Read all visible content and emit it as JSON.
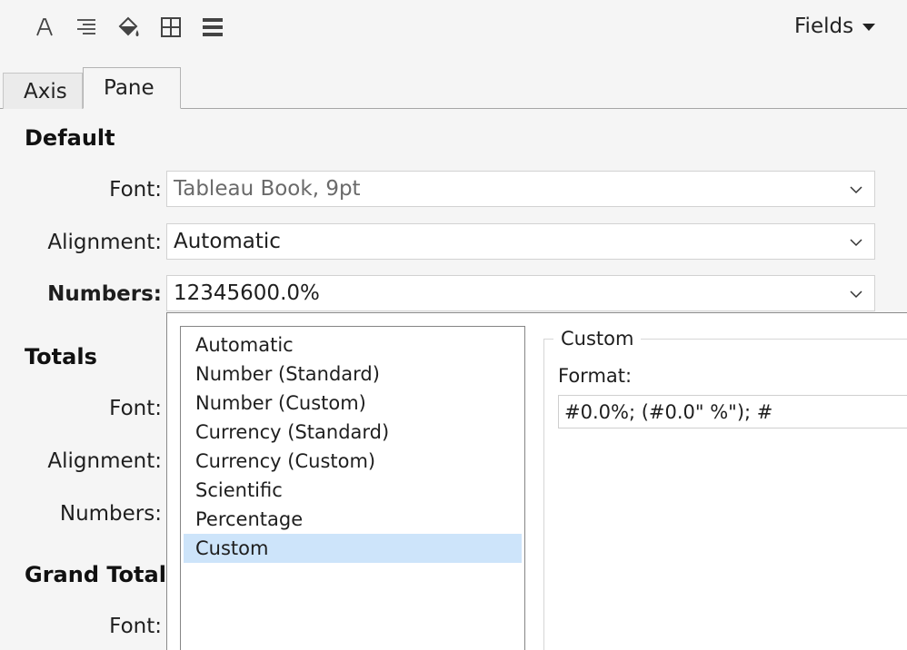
{
  "toolbar": {
    "icons": [
      "font-icon",
      "alignment-icon",
      "shading-icon",
      "borders-icon",
      "lines-icon"
    ],
    "fields_label": "Fields"
  },
  "tabs": [
    {
      "label": "Axis",
      "active": false
    },
    {
      "label": "Pane",
      "active": true
    }
  ],
  "default": {
    "heading": "Default",
    "font_label": "Font:",
    "font_value": "Tableau Book, 9pt",
    "alignment_label": "Alignment:",
    "alignment_value": "Automatic",
    "numbers_label": "Numbers:",
    "numbers_value": "12345600.0%"
  },
  "totals": {
    "heading": "Totals",
    "font_label": "Font:",
    "alignment_label": "Alignment:",
    "numbers_label": "Numbers:"
  },
  "grand_totals": {
    "heading": "Grand Totals",
    "font_label": "Font:"
  },
  "number_format_popup": {
    "options": [
      "Automatic",
      "Number (Standard)",
      "Number (Custom)",
      "Currency (Standard)",
      "Currency (Custom)",
      "Scientific",
      "Percentage",
      "Custom"
    ],
    "selected": "Custom",
    "group_title": "Custom",
    "format_label": "Format:",
    "format_value": "#0.0%; (#0.0\" %\"); #"
  },
  "colors": {
    "selection": "#cde4fa",
    "panel_bg": "#f5f5f5"
  }
}
